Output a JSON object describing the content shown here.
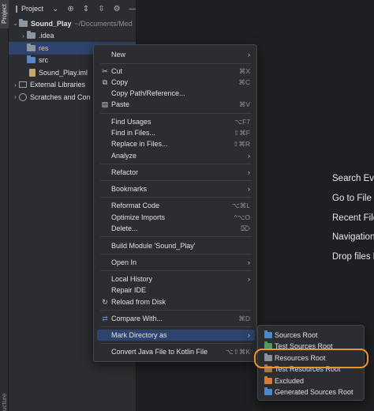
{
  "tool_strip": {
    "project_tab": "Project",
    "structure_tab": "ucture"
  },
  "project_panel": {
    "title": "Project",
    "tree": [
      {
        "label": "Sound_Play",
        "path": "~/Documents/Med",
        "kind": "project"
      },
      {
        "label": ".idea",
        "kind": "folder"
      },
      {
        "label": "res",
        "kind": "folder"
      },
      {
        "label": "src",
        "kind": "folder-blue"
      },
      {
        "label": "Sound_Play.iml",
        "kind": "file"
      },
      {
        "label": "External Libraries",
        "kind": "library"
      },
      {
        "label": "Scratches and Con",
        "kind": "scratch"
      }
    ]
  },
  "editor_hints": [
    "Search Eve",
    "Go to File",
    "Recent File",
    "Navigation",
    "Drop files h"
  ],
  "context_menu": {
    "items": [
      {
        "label": "New",
        "submenu": true
      },
      {
        "label": "Cut",
        "shortcut": "⌘X",
        "icon": "✂"
      },
      {
        "label": "Copy",
        "shortcut": "⌘C",
        "icon": "⧉"
      },
      {
        "label": "Copy Path/Reference...",
        "shortcut": ""
      },
      {
        "label": "Paste",
        "shortcut": "⌘V",
        "icon": "📋"
      },
      {
        "label": "Find Usages",
        "shortcut": "⌥F7"
      },
      {
        "label": "Find in Files...",
        "shortcut": "⇧⌘F"
      },
      {
        "label": "Replace in Files...",
        "shortcut": "⇧⌘R"
      },
      {
        "label": "Analyze",
        "submenu": true
      },
      {
        "label": "Refactor",
        "submenu": true
      },
      {
        "label": "Bookmarks",
        "submenu": true
      },
      {
        "label": "Reformat Code",
        "shortcut": "⌥⌘L"
      },
      {
        "label": "Optimize Imports",
        "shortcut": "^⌥O"
      },
      {
        "label": "Delete...",
        "shortcut": "⌦"
      },
      {
        "label": "Build Module 'Sound_Play'",
        "shortcut": ""
      },
      {
        "label": "Open In",
        "submenu": true
      },
      {
        "label": "Local History",
        "submenu": true
      },
      {
        "label": "Repair IDE",
        "shortcut": ""
      },
      {
        "label": "Reload from Disk",
        "shortcut": "",
        "icon": "↻"
      },
      {
        "label": "Compare With...",
        "shortcut": "⌘D",
        "icon": "⇄"
      },
      {
        "label": "Mark Directory as",
        "submenu": true,
        "highlighted": true
      },
      {
        "label": "Convert Java File to Kotlin File",
        "shortcut": "⌥⇧⌘K"
      }
    ]
  },
  "mark_directory_submenu": {
    "items": [
      {
        "label": "Sources Root",
        "color": "#4a88c7"
      },
      {
        "label": "Test Sources Root",
        "color": "#4f9a5a"
      },
      {
        "label": "Resources Root",
        "color": "#8a8f98",
        "highlighted": true
      },
      {
        "label": "Test Resources Root",
        "color": "#9a7a5a"
      },
      {
        "label": "Excluded",
        "color": "#d27b3a"
      },
      {
        "label": "Generated Sources Root",
        "color": "#4a88c7"
      }
    ]
  },
  "colors": {
    "accent_highlight": "#2e436e",
    "callout": "#f0932b"
  }
}
